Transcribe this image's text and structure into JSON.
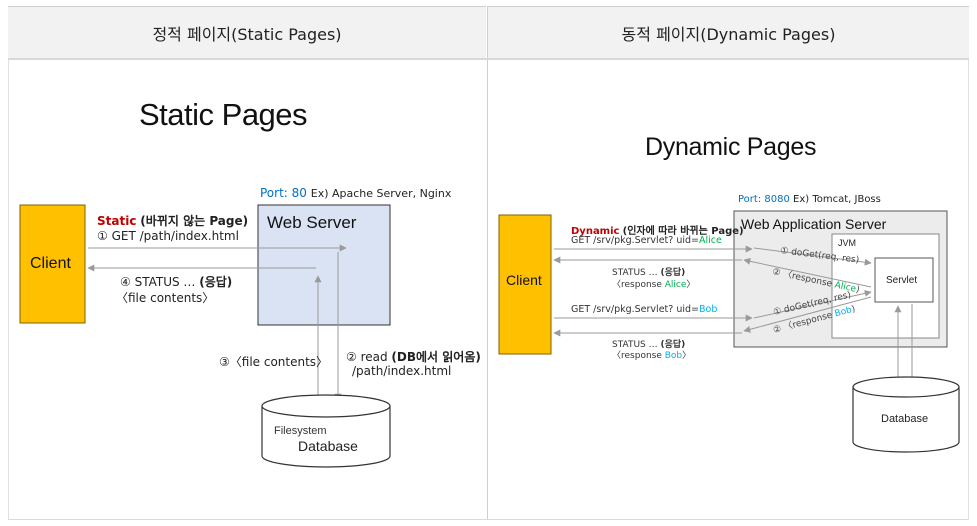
{
  "headers": {
    "static": "정적 페이지(Static Pages)",
    "dynamic": "동적 페이지(Dynamic Pages)"
  },
  "static": {
    "title": "Static Pages",
    "port_label": "Port: 80",
    "port_example": "Ex) Apache Server, Nginx",
    "client": "Client",
    "web_server": "Web Server",
    "req_keyword": "Static",
    "req_desc": "(바뀌지 않는 Page)",
    "req_line": "① GET /path/index.html",
    "resp_line": "④ STATUS … ",
    "resp_bold": "(응답)",
    "resp_contents": "〈file contents〉",
    "read_line": "② read ",
    "read_bold": "(DB에서 읽어옴)",
    "read_path": "/path/index.html",
    "file_contents": "③〈file contents〉",
    "db_sub": "Filesystem",
    "db_name": "Database"
  },
  "dynamic": {
    "title": "Dynamic Pages",
    "port_label": "Port: 8080",
    "port_example": "Ex) Tomcat, JBoss",
    "client": "Client",
    "was": "Web Application Server",
    "jvm": "JVM",
    "servlet": "Servlet",
    "req_keyword": "Dynamic",
    "req_desc": "(인자에 따라 바뀌는 Page)",
    "get_prefix": "GET /srv/pkg.Servlet? uid=",
    "user1": "Alice",
    "user2": "Bob",
    "status_line": "STATUS … ",
    "status_bold": "(응답)",
    "response_prefix": "〈response ",
    "call1": "① doGet(req, res)",
    "call2": "② 〈response ",
    "db_name": "Database"
  },
  "colors": {
    "client_fill": "#ffc000",
    "static_server_fill": "#dae3f3",
    "was_fill": "#ececec",
    "port_blue": "#0070c0",
    "keyword_red": "#c00000",
    "alice_green": "#00b050",
    "bob_blue": "#00b0f0"
  }
}
